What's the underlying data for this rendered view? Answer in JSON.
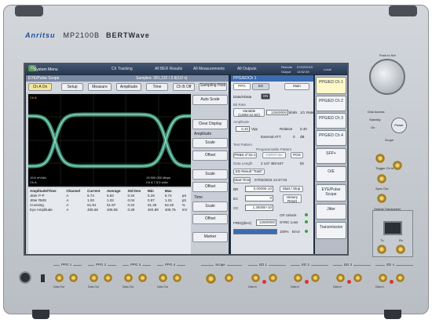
{
  "device": {
    "brand": "Anritsu",
    "model": "MP2100B",
    "product": "BERTWave"
  },
  "topbar": {
    "menu": "System Menu",
    "tracking": "Ch Tracking",
    "ber_all": "All BER Results",
    "meas_all": "All Measurements",
    "outputs_all": "All Outputs",
    "date": "07/02/2015",
    "time": "14:52:39",
    "status_remote": "Remote",
    "status_output": "Output",
    "status_local": "Local"
  },
  "scope": {
    "title": "EYE/Pulse Scope",
    "samples": "Samples: 391,132 / 2.9(1/2 s)",
    "toolbar": [
      "Ch A On",
      "Setup",
      "Measure",
      "Amplitude",
      "Time",
      "Ch B Off"
    ],
    "sampling_hold": "Sampling Hold",
    "side": [
      "Auto Scale",
      "Clear Display",
      "Scale",
      "Offset",
      "Scale",
      "Offset",
      "Scale",
      "Offset",
      "Marker"
    ],
    "side_labels": {
      "amplitude": "Amplitude",
      "time": "Time"
    },
    "plot_left_top": "Ch A",
    "plot_left_bottom": "19.6 mV/div",
    "plot_left_bottom2": "Ch A",
    "plot_right_bottom": "13 500 000 Mbps",
    "plot_right_bottom2": "Ch A 7.5 0 s/div"
  },
  "meas_table": {
    "headers": [
      "Amplitude/Time",
      "Channel",
      "Current",
      "Average",
      "Std Dev",
      "Min",
      "Max",
      ""
    ],
    "rows": [
      [
        "Jitter P-P",
        "A",
        "6.74",
        "5.83",
        "0.34",
        "5.29",
        "6.74",
        "pS"
      ],
      [
        "Jitter RMS",
        "A",
        "1.00",
        "1.03",
        "0.04",
        "0.97",
        "1.15",
        "pS"
      ],
      [
        "Crossing",
        "A",
        "51.81",
        "51.87",
        "0.22",
        "51.45",
        "52.25",
        "%"
      ],
      [
        "Eye Amplitude",
        "A",
        "405.66",
        "405.05",
        "0.39",
        "404.89",
        "405.76",
        "mV"
      ]
    ]
  },
  "ppg": {
    "title": "PPG/EDCh 1",
    "tabs": [
      "PPG",
      "ED"
    ],
    "main": "Main",
    "data_label": "Data/XData",
    "data_state": "ON",
    "bit_rate_label": "Bit Rate",
    "variable": "Variable",
    "variable_range": "(125M-12.5G)",
    "bit_rate": "12500000",
    "bit_rate_unit": "kbit/s",
    "ratio": "1/1",
    "rate_label": "Rate",
    "amplitude_label": "Amplitude",
    "amp_value": "0.40",
    "amp_unit": "Vpp",
    "relative_label": "Relative",
    "relative_value": "0.40",
    "external_att": "External ATT",
    "att_value": "0",
    "att_unit": "dB",
    "test_pattern_label": "Test Pattern",
    "programmable_pattern": "Programmable Pattern",
    "prbs": "PRBS 2^31-1",
    "cspatt": "CSPAT-ine",
    "pos": "POS",
    "data_length_label": "Data Length",
    "data_length_value": "2 147 483 647",
    "data_length_unit": "bit",
    "ed_result": "ED Result \"Total\"",
    "start_time_label": "Start Time",
    "start_time": "07/02/2015 14:47:04",
    "ber_label": "BR",
    "ber_value": "0.0000E-10",
    "start_stop": "Start / Stop",
    "ec_label": "EC",
    "ec_value": "0",
    "history_reset": "History Reset",
    "cc_label": "CC",
    "cc_value": "1.2500E+10",
    "cr_unlock": "CR Unlock",
    "sync_loss": "SYNC Loss",
    "error": "Error",
    "freq_label": "FREQ(kHz)",
    "freq_value": "12500000",
    "progress_pct": "100%",
    "progress": 1.0
  },
  "nav": [
    {
      "label": "PPG/ED Ch 1",
      "active": true
    },
    {
      "label": "PPG/ED Ch 2",
      "active": false
    },
    {
      "label": "PPG/ED Ch 3",
      "active": false
    },
    {
      "label": "PPG/ED Ch 4",
      "active": false
    },
    {
      "label": "SFP+",
      "active": false
    },
    {
      "label": "O/E",
      "active": false
    },
    {
      "label": "EYE/Pulse Scope",
      "active": false
    },
    {
      "label": "Jitter",
      "active": false
    },
    {
      "label": "Transmission",
      "active": false
    }
  ],
  "right_panel": {
    "push_to_set": "Push to Set",
    "disk_access": "Disk Access",
    "standby": "Standby",
    "on": "On",
    "power": "Power",
    "scope": "Scope",
    "trigger": "Trigger Ch In",
    "sync_out": "Sync Out",
    "opt_transceiver": "Optical Transceiver",
    "tx": "Tx",
    "rx": "Rx"
  },
  "bottom": {
    "groups": [
      {
        "label": "PPG 1"
      },
      {
        "label": "PPG 2"
      },
      {
        "label": "PPG 3"
      },
      {
        "label": "PPG 4"
      },
      {
        "label": "Scope"
      },
      {
        "label": "ED 1"
      },
      {
        "label": "ED 2"
      },
      {
        "label": "ED 3"
      },
      {
        "label": "ED 4"
      }
    ],
    "data_out": "Data Out",
    "xdata_out": "XData Out",
    "data_in": "Data In",
    "xdata_in": "XData In"
  },
  "colors": {
    "accent": "#3c6bb0",
    "screen_bg": "#1e2a3c",
    "eye_color": "#3fa88a",
    "warning_led": "#d33"
  }
}
